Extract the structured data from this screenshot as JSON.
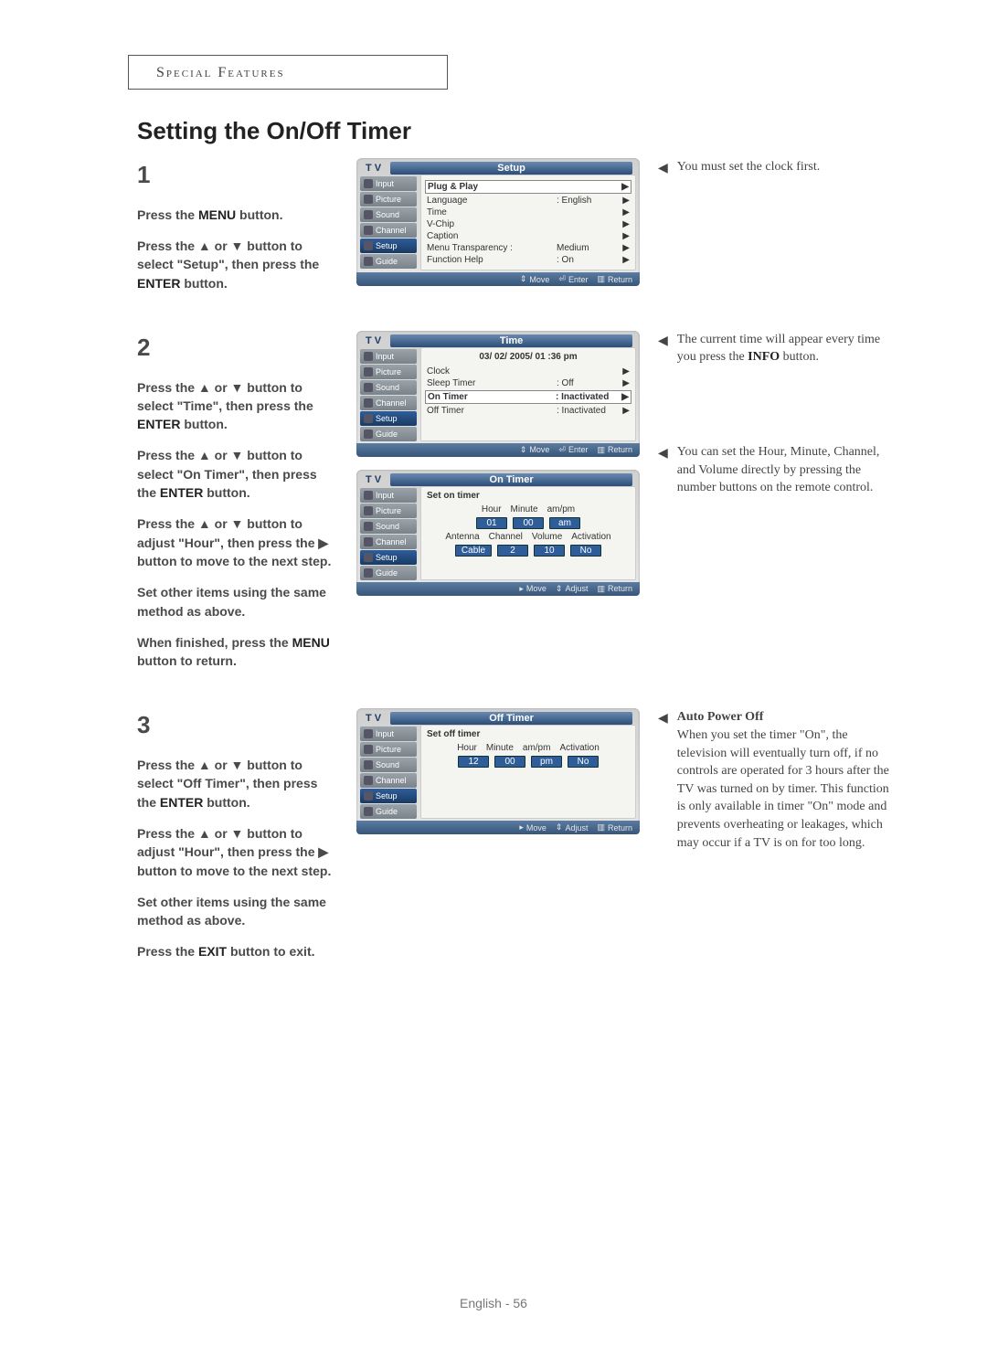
{
  "header": "Special Features",
  "title": "Setting the On/Off Timer",
  "steps": {
    "s1": {
      "num": "1",
      "p1a": "Press the ",
      "p1b": "MENU",
      "p1c": " button.",
      "p2a": "Press the ▲ or ▼ button to select \"Setup\", then press the ",
      "p2b": "ENTER",
      "p2c": " button."
    },
    "s2": {
      "num": "2",
      "p1a": "Press the ▲ or ▼ button to select \"Time\", then press the ",
      "p1b": "ENTER",
      "p1c": " button.",
      "p2a": "Press the ▲ or ▼ button to select \"On Timer\", then press the ",
      "p2b": "ENTER",
      "p2c": " button.",
      "p3": "Press the ▲ or ▼ button to adjust \"Hour\", then press the ▶ button to move to the next step.",
      "p4": "Set other items using the same method as above.",
      "p5a": "When finished, press the ",
      "p5b": "MENU",
      "p5c": " button to return."
    },
    "s3": {
      "num": "3",
      "p1a": "Press the ▲ or ▼ button to select \"Off Timer\", then press the ",
      "p1b": "ENTER",
      "p1c": " button.",
      "p2": "Press the ▲ or ▼ button to adjust \"Hour\", then press the ▶ button to move to the next step.",
      "p3": "Set other items using the same method as above.",
      "p4a": "Press the ",
      "p4b": "EXIT",
      "p4c": " button to exit."
    }
  },
  "notes": {
    "n1": "You must set the clock first.",
    "n2a": "The current time will appear every time you press the ",
    "n2b": "INFO",
    "n2c": " button.",
    "n3": "You can set the Hour, Minute, Channel, and Volume directly by pressing the number buttons on the remote control.",
    "n4title": "Auto Power Off",
    "n4": "When you set the timer \"On\", the television will eventually turn off, if no controls are operated for 3 hours after the TV was turned on by timer. This function is only available in timer \"On\" mode and prevents overheating or leakages, which may occur if a TV is on for too long."
  },
  "osd": {
    "tabs": [
      "Input",
      "Picture",
      "Sound",
      "Channel",
      "Setup",
      "Guide"
    ],
    "setup": {
      "title": "Setup",
      "rows": [
        {
          "label": "Plug & Play",
          "val": "",
          "arrow": "▶",
          "hl": true
        },
        {
          "label": "Language",
          "val": ":  English",
          "arrow": "▶"
        },
        {
          "label": "Time",
          "val": "",
          "arrow": "▶"
        },
        {
          "label": "V-Chip",
          "val": "",
          "arrow": "▶"
        },
        {
          "label": "Caption",
          "val": "",
          "arrow": "▶"
        },
        {
          "label": "Menu Transparency :",
          "val": "Medium",
          "arrow": "▶"
        },
        {
          "label": "Function Help",
          "val": ":  On",
          "arrow": "▶"
        }
      ],
      "foot": [
        "Move",
        "Enter",
        "Return"
      ]
    },
    "time": {
      "title": "Time",
      "date": "03/ 02/ 2005/ 01 :36  pm",
      "rows": [
        {
          "label": "Clock",
          "val": "",
          "arrow": "▶"
        },
        {
          "label": "Sleep Timer",
          "val": ":  Off",
          "arrow": "▶"
        },
        {
          "label": "On Timer",
          "val": ":  Inactivated",
          "arrow": "▶",
          "hl": true
        },
        {
          "label": "Off Timer",
          "val": ":  Inactivated",
          "arrow": "▶"
        }
      ],
      "foot": [
        "Move",
        "Enter",
        "Return"
      ]
    },
    "ontimer": {
      "title": "On Timer",
      "heading": "Set on timer",
      "cols1": [
        "Hour",
        "Minute",
        "am/pm"
      ],
      "vals1": [
        "01",
        "00",
        "am"
      ],
      "cols2": [
        "Antenna",
        "Channel",
        "Volume",
        "Activation"
      ],
      "vals2": [
        "Cable",
        "2",
        "10",
        "No"
      ],
      "foot": [
        "Move",
        "Adjust",
        "Return"
      ]
    },
    "offtimer": {
      "title": "Off Timer",
      "heading": "Set off timer",
      "cols": [
        "Hour",
        "Minute",
        "am/pm",
        "Activation"
      ],
      "vals": [
        "12",
        "00",
        "pm",
        "No"
      ],
      "foot": [
        "Move",
        "Adjust",
        "Return"
      ]
    }
  },
  "footer": "English - 56"
}
